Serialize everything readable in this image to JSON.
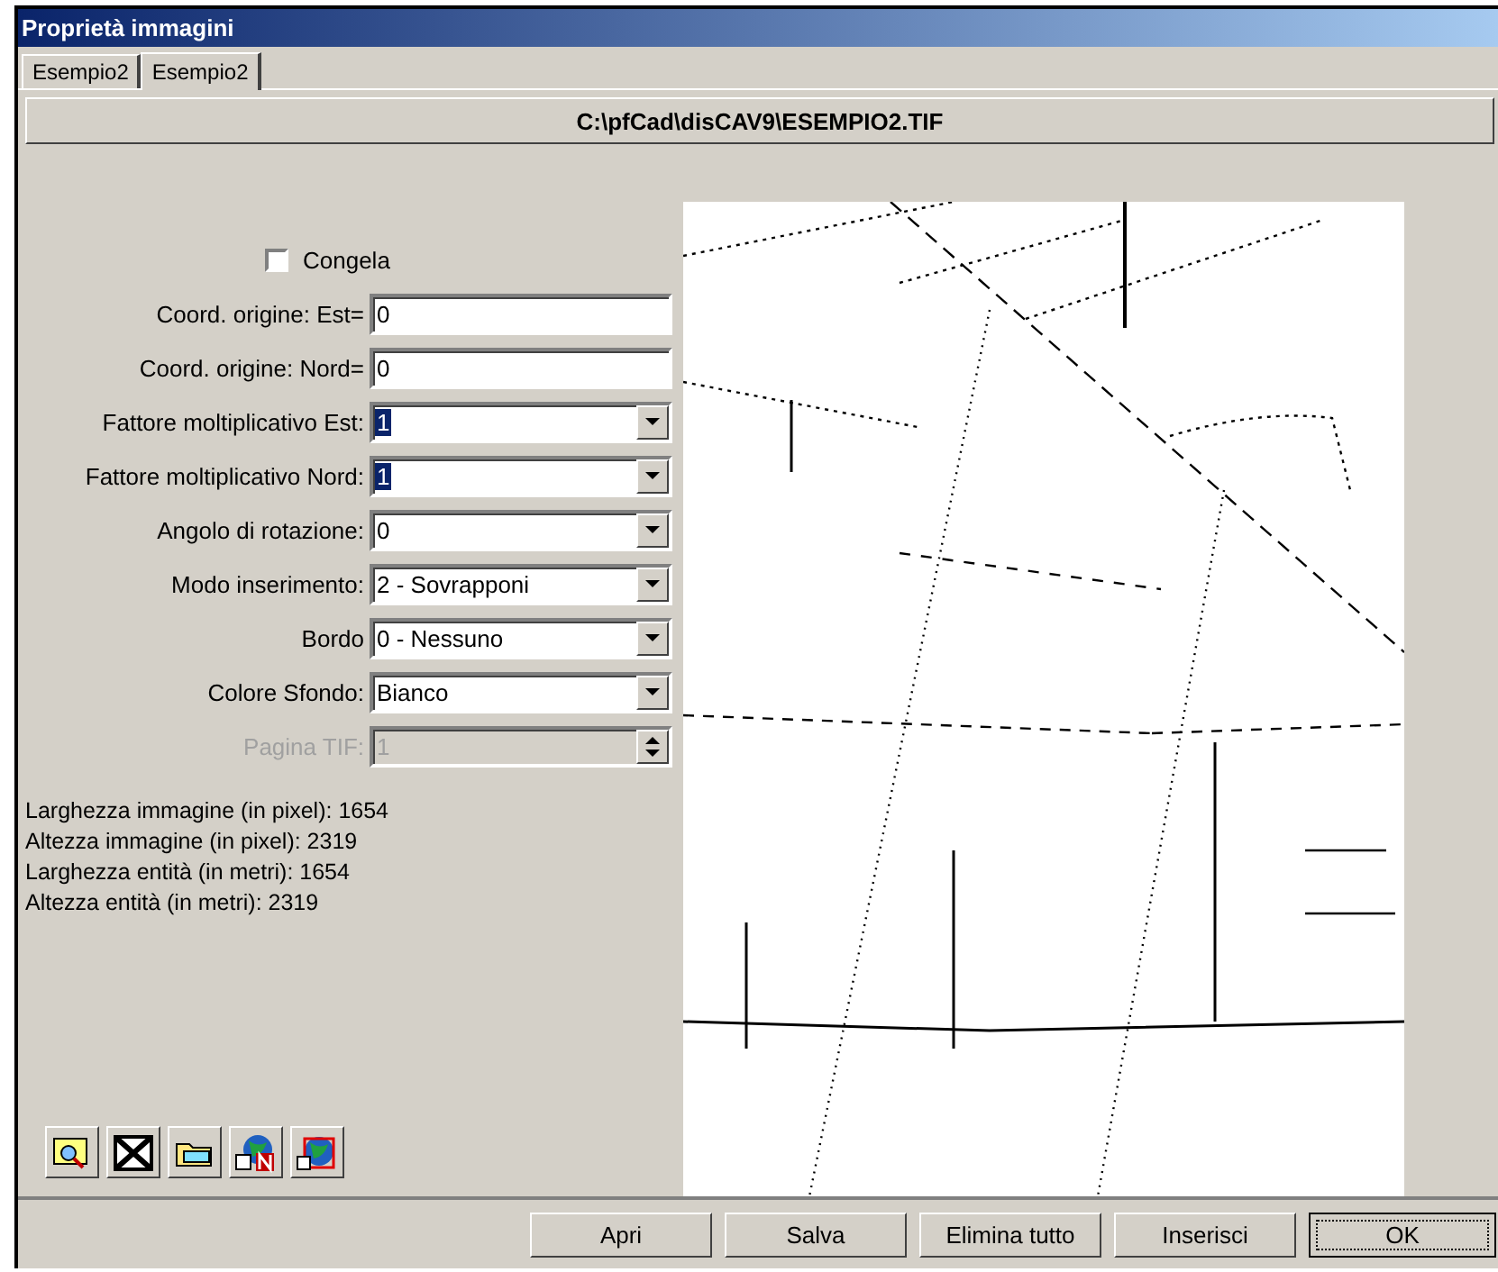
{
  "window": {
    "title": "Proprietà immagini"
  },
  "tabs": [
    {
      "label": "Esempio2",
      "selected": false
    },
    {
      "label": "Esempio2",
      "selected": true
    }
  ],
  "path": "C:\\pfCad\\disCAV9\\ESEMPIO2.TIF",
  "freeze": {
    "label": "Congela",
    "checked": false
  },
  "fields": [
    {
      "kind": "text",
      "label": "Coord. origine: Est=",
      "value": "0",
      "selected": false,
      "disabled": false
    },
    {
      "kind": "text",
      "label": "Coord. origine: Nord=",
      "value": "0",
      "selected": false,
      "disabled": false
    },
    {
      "kind": "combo",
      "label": "Fattore moltiplicativo Est:",
      "value": "1",
      "selected": true,
      "disabled": false
    },
    {
      "kind": "combo",
      "label": "Fattore moltiplicativo Nord:",
      "value": "1",
      "selected": true,
      "disabled": false
    },
    {
      "kind": "combo",
      "label": "Angolo di rotazione:",
      "value": "0",
      "selected": false,
      "disabled": false
    },
    {
      "kind": "combo",
      "label": "Modo inserimento:",
      "value": "2 - Sovrapponi",
      "selected": false,
      "disabled": false
    },
    {
      "kind": "combo",
      "label": "Bordo",
      "value": "0 - Nessuno",
      "selected": false,
      "disabled": false
    },
    {
      "kind": "combo",
      "label": "Colore Sfondo:",
      "value": "Bianco",
      "selected": false,
      "disabled": false
    },
    {
      "kind": "spin",
      "label": "Pagina TIF:",
      "value": "1",
      "selected": false,
      "disabled": true
    }
  ],
  "info": [
    "Larghezza immagine (in pixel): 1654",
    "Altezza immagine (in pixel): 2319",
    "Larghezza entità (in metri): 1654",
    "Altezza entità (in metri): 2319"
  ],
  "tools": [
    {
      "kind": "zoom"
    },
    {
      "kind": "delete"
    },
    {
      "kind": "folder"
    },
    {
      "kind": "new"
    },
    {
      "kind": "grid"
    }
  ],
  "image": {
    "kind": "picture"
  },
  "buttons": [
    {
      "label": "Apri",
      "default": false
    },
    {
      "label": "Salva",
      "default": false
    },
    {
      "label": "Elimina tutto",
      "default": false
    },
    {
      "label": "Inserisci",
      "default": false
    },
    {
      "label": "OK",
      "default": true
    }
  ]
}
